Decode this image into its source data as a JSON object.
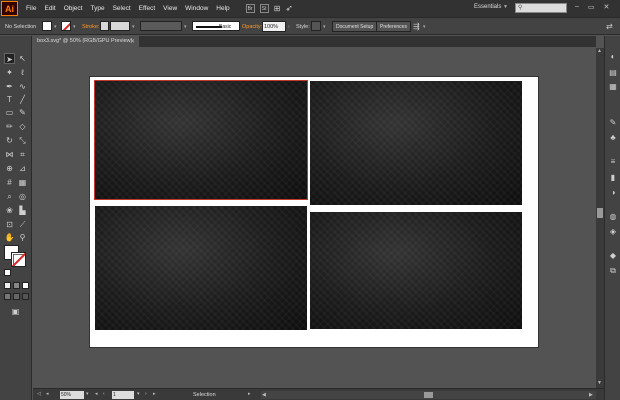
{
  "app": {
    "logo": "Ai"
  },
  "menubar": {
    "items": [
      "File",
      "Edit",
      "Object",
      "Type",
      "Select",
      "Effect",
      "View",
      "Window",
      "Help"
    ],
    "br_icon": "Br",
    "st_icon": "St",
    "workspace": "Essentials"
  },
  "controlbar": {
    "selection_label": "No Selection",
    "stroke_label": "Stroke:",
    "brush_label": "Basic",
    "opacity_label": "Opacity:",
    "opacity_value": "100%",
    "style_label": "Style:",
    "document_setup": "Document Setup",
    "preferences": "Preferences"
  },
  "document": {
    "tab_title": "box3.svg* @ 50% (RGB/GPU Preview)"
  },
  "statusbar": {
    "zoom": "50%",
    "page": "1",
    "mode": "Selection"
  },
  "colors": {
    "accent": "#ff9a2a",
    "selection": "#c0392b",
    "canvas": "#535353",
    "artboard": "#ffffff"
  },
  "icons": {
    "tools": [
      "selection-tool",
      "direct-selection-tool",
      "magic-wand-tool",
      "lasso-tool",
      "pen-tool",
      "curvature-tool",
      "type-tool",
      "line-tool",
      "rectangle-tool",
      "paintbrush-tool",
      "pencil-tool",
      "eraser-tool",
      "rotate-tool",
      "scale-tool",
      "width-tool",
      "free-transform-tool",
      "shape-builder-tool",
      "perspective-grid-tool",
      "mesh-tool",
      "gradient-tool",
      "eyedropper-tool",
      "blend-tool",
      "symbol-sprayer-tool",
      "column-graph-tool",
      "artboard-tool",
      "slice-tool",
      "hand-tool",
      "zoom-tool"
    ]
  }
}
